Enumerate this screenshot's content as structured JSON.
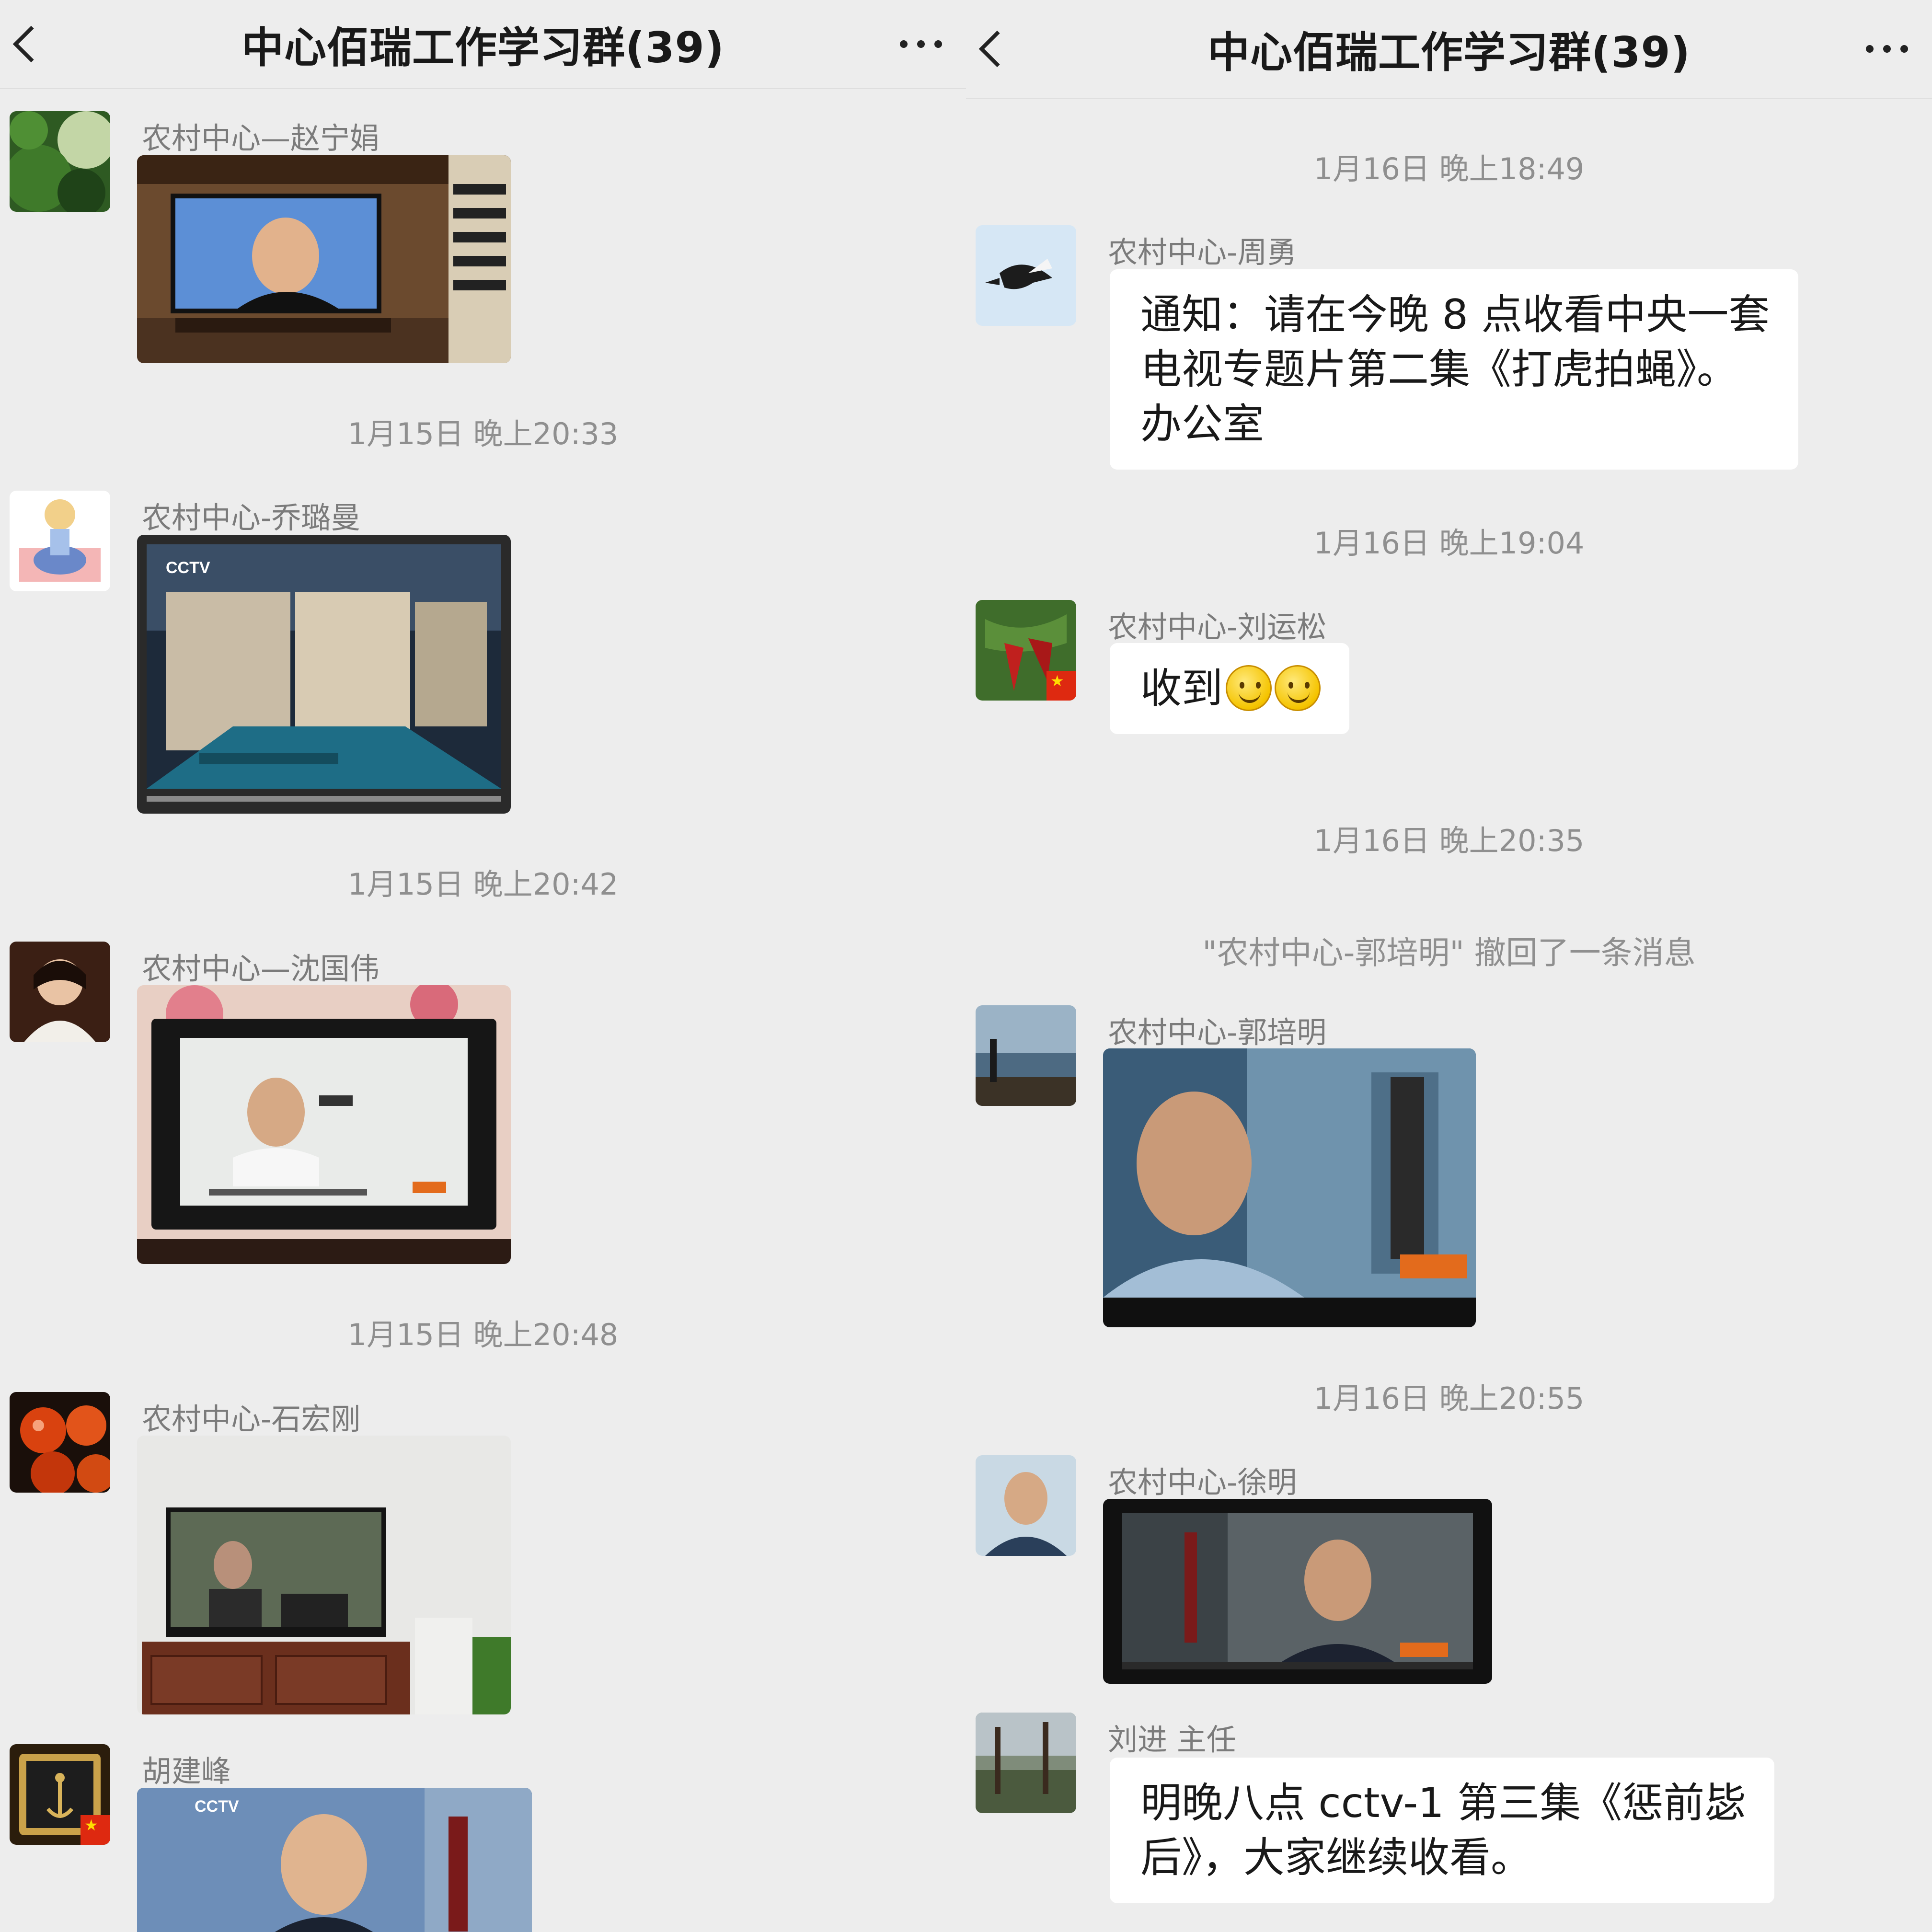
{
  "left": {
    "header": {
      "title": "中心佰瑞工作学习群(39)"
    },
    "messages": [
      {
        "sender": "农村中心—赵宁娟"
      },
      {
        "time": "1月15日 晚上20:33",
        "sender": "农村中心-乔璐曼"
      },
      {
        "time": "1月15日 晚上20:42",
        "sender": "农村中心—沈国伟"
      },
      {
        "time": "1月15日 晚上20:48",
        "sender": "农村中心-石宏刚"
      },
      {
        "sender": "胡建峰"
      }
    ]
  },
  "right": {
    "header": {
      "title": "中心佰瑞工作学习群(39)"
    },
    "messages": [
      {
        "time": "1月16日 晚上18:49",
        "sender": "农村中心-周勇",
        "lines": [
          "通知：请在今晚 8 点收看中央一套",
          "电视专题片第二集《打虎拍蝇》。",
          "办公室"
        ]
      },
      {
        "time": "1月16日 晚上19:04",
        "sender": "农村中心-刘运松",
        "text": "收到"
      },
      {
        "time": "1月16日 晚上20:35",
        "system": "\"农村中心-郭培明\" 撤回了一条消息",
        "sender": "农村中心-郭培明"
      },
      {
        "time": "1月16日 晚上20:55",
        "sender": "农村中心-徐明"
      },
      {
        "sender": "刘进 主任",
        "lines": [
          "明晚八点 cctv-1 第三集《惩前毖",
          "后》，大家继续收看。"
        ]
      }
    ]
  },
  "icons": {
    "back": "chevron-left-icon",
    "more": "more-dots-icon",
    "emoji": "smile-emoji-icon",
    "flag": "china-flag-icon"
  },
  "colors": {
    "background": "#ededed",
    "bubble": "#ffffff",
    "meta_text": "#8f8f8f"
  }
}
